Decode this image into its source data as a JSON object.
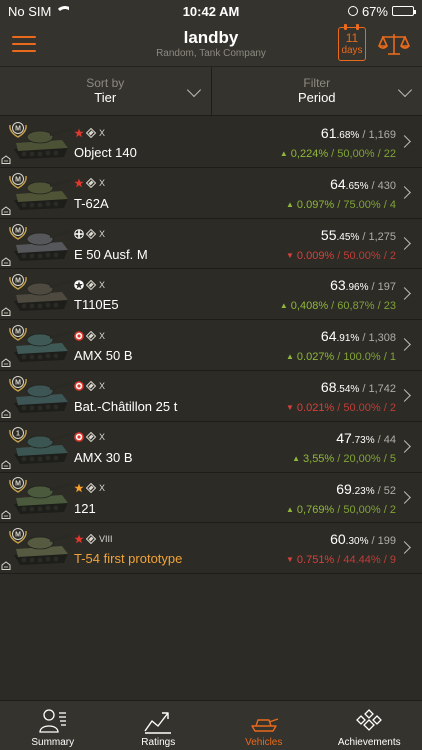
{
  "status": {
    "carrier": "No SIM",
    "time": "10:42 AM",
    "battery": "67%",
    "battery_level": 0.67
  },
  "header": {
    "title": "landby",
    "subtitle": "Random, Tank Company",
    "days_number": "11",
    "days_label": "days"
  },
  "controls": {
    "sort": {
      "label": "Sort by",
      "value": "Tier"
    },
    "filter": {
      "label": "Filter",
      "value": "Period"
    }
  },
  "colors": {
    "accent": "#e96a1c",
    "up": "#8fb83a",
    "down": "#d8413a",
    "premium": "#f0a33a"
  },
  "vehicles": [
    {
      "name": "Object 140",
      "nation": "ussr",
      "tier": "X",
      "mastery": "M",
      "premium": false,
      "wr_main": "61",
      "wr_dec": ".68%",
      "battles": " / 1,169",
      "trend": "up",
      "delta": "0,224%",
      "delta_wr": " / 50,00%",
      "delta_battles": " / 22",
      "camo": "#4c5236"
    },
    {
      "name": "T-62A",
      "nation": "ussr",
      "tier": "X",
      "mastery": "M",
      "premium": false,
      "wr_main": "64",
      "wr_dec": ".65%",
      "battles": " / 430",
      "trend": "up",
      "delta": "0.097%",
      "delta_wr": " / 75.00%",
      "delta_battles": " / 4",
      "camo": "#4f5436"
    },
    {
      "name": "E 50 Ausf. M",
      "nation": "germany",
      "tier": "X",
      "mastery": "M",
      "premium": false,
      "wr_main": "55",
      "wr_dec": ".45%",
      "battles": " / 1,275",
      "trend": "down",
      "delta": "0.009%",
      "delta_wr": " / 50.00%",
      "delta_battles": " / 2",
      "camo": "#55575a"
    },
    {
      "name": "T110E5",
      "nation": "usa",
      "tier": "X",
      "mastery": "M",
      "premium": false,
      "wr_main": "63",
      "wr_dec": ".96%",
      "battles": " / 197",
      "trend": "up",
      "delta": "0,408%",
      "delta_wr": " / 60,87%",
      "delta_battles": " / 23",
      "camo": "#4e4a40"
    },
    {
      "name": "AMX 50 B",
      "nation": "france",
      "tier": "X",
      "mastery": "M",
      "premium": false,
      "wr_main": "64",
      "wr_dec": ".91%",
      "battles": " / 1,308",
      "trend": "up",
      "delta": "0.027%",
      "delta_wr": " / 100.0%",
      "delta_battles": " / 1",
      "camo": "#3f5a56"
    },
    {
      "name": "Bat.-Châtillon 25 t",
      "nation": "france",
      "tier": "X",
      "mastery": "M",
      "premium": false,
      "wr_main": "68",
      "wr_dec": ".54%",
      "battles": " / 1,742",
      "trend": "down",
      "delta": "0.021%",
      "delta_wr": " / 50.00%",
      "delta_battles": " / 2",
      "camo": "#3d5655"
    },
    {
      "name": "AMX 30 B",
      "nation": "france",
      "tier": "X",
      "mastery": "1",
      "premium": false,
      "wr_main": "47",
      "wr_dec": ".73%",
      "battles": " / 44",
      "trend": "up",
      "delta": "3,55%",
      "delta_wr": " / 20,00%",
      "delta_battles": " / 5",
      "camo": "#3b5552"
    },
    {
      "name": "121",
      "nation": "china",
      "tier": "X",
      "mastery": "M",
      "premium": false,
      "wr_main": "69",
      "wr_dec": ".23%",
      "battles": " / 52",
      "trend": "up",
      "delta": "0,769%",
      "delta_wr": " / 50,00%",
      "delta_battles": " / 2",
      "camo": "#4b5a3c"
    },
    {
      "name": "T-54 first prototype",
      "nation": "ussr",
      "tier": "VIII",
      "mastery": "M",
      "premium": true,
      "wr_main": "60",
      "wr_dec": ".30%",
      "battles": " / 199",
      "trend": "down",
      "delta": "0.751%",
      "delta_wr": " / 44.44%",
      "delta_battles": " / 9",
      "camo": "#555a40"
    }
  ],
  "tabs": [
    {
      "label": "Summary",
      "icon": "summary-icon"
    },
    {
      "label": "Ratings",
      "icon": "ratings-icon"
    },
    {
      "label": "Vehicles",
      "icon": "vehicles-icon",
      "active": true
    },
    {
      "label": "Achievements",
      "icon": "achievements-icon"
    }
  ]
}
